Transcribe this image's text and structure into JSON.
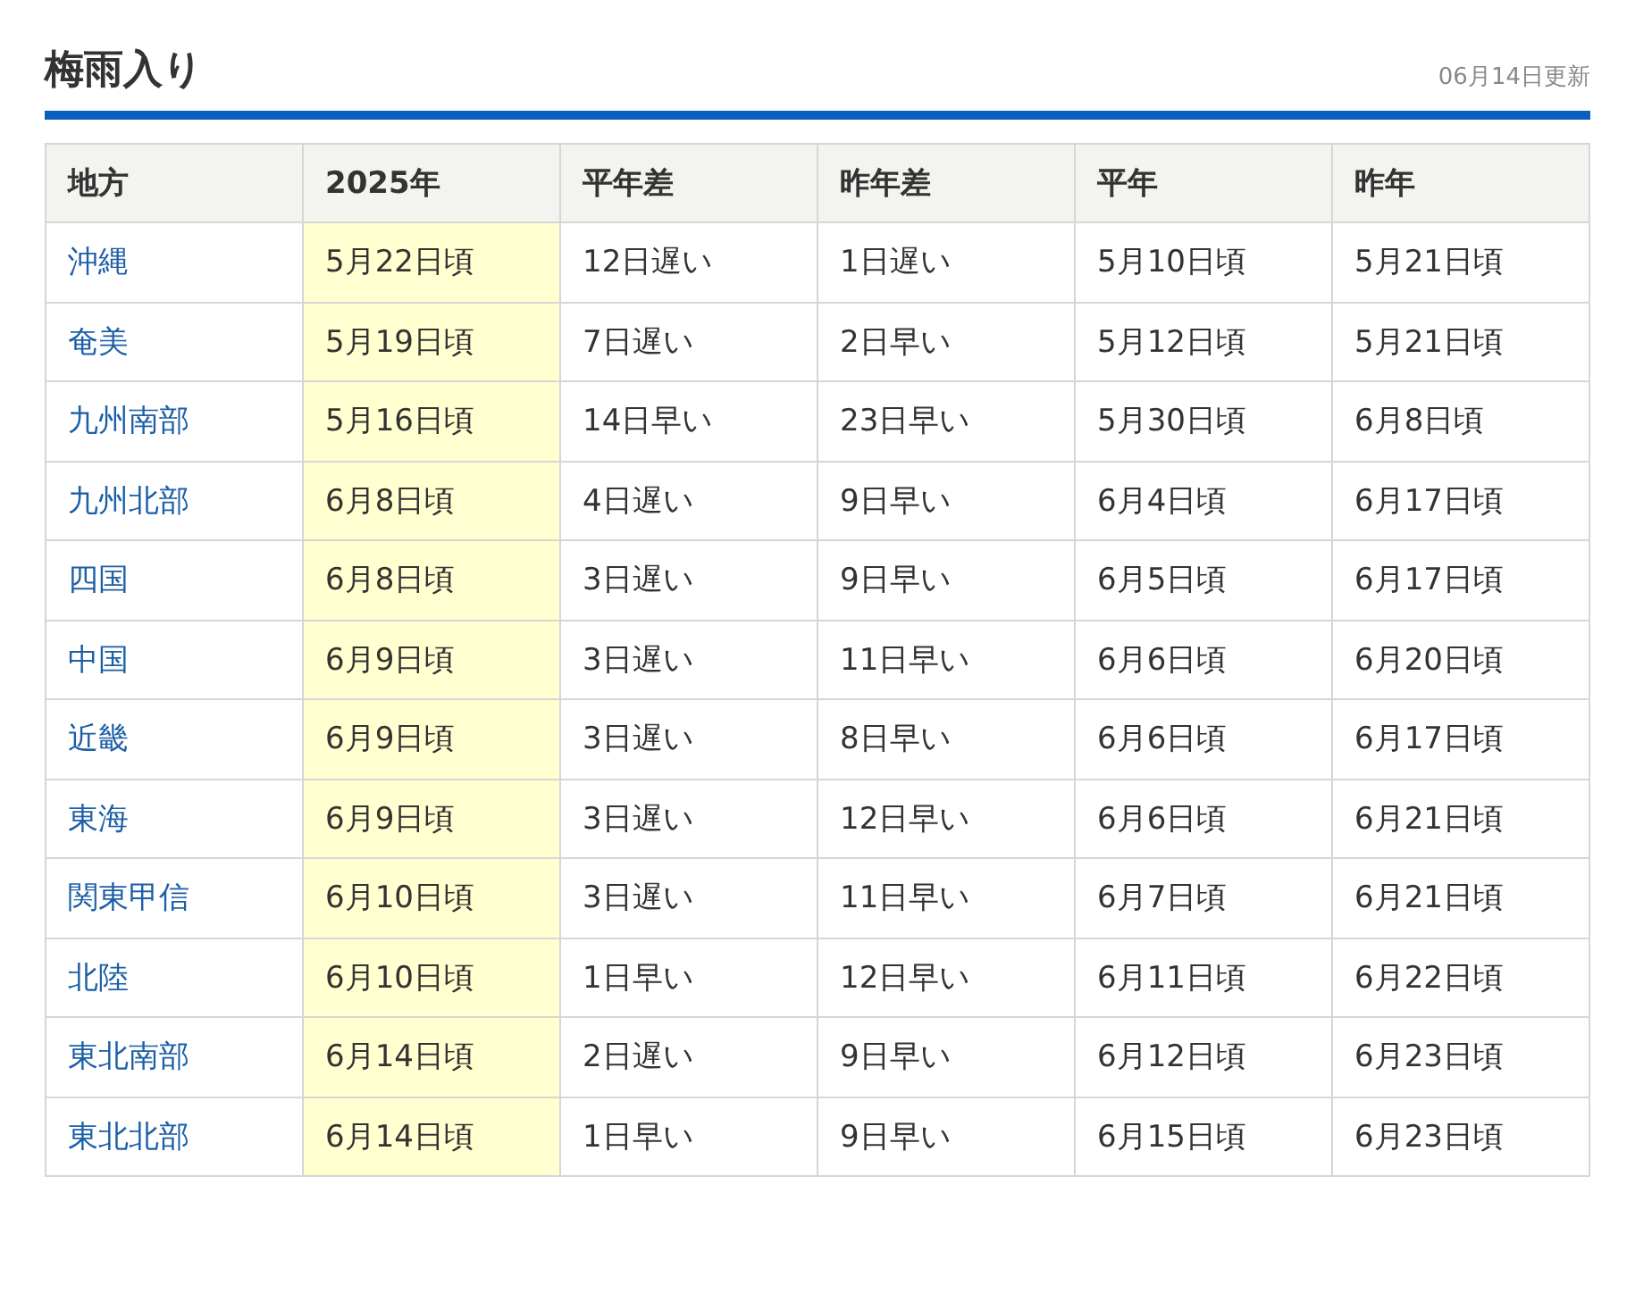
{
  "header": {
    "title": "梅雨入り",
    "updated": "06月14日更新"
  },
  "table": {
    "columns": [
      {
        "label": "地方",
        "highlighted": false
      },
      {
        "label": "2025年",
        "highlighted": true
      },
      {
        "label": "平年差",
        "highlighted": false
      },
      {
        "label": "昨年差",
        "highlighted": false
      },
      {
        "label": "平年",
        "highlighted": false
      },
      {
        "label": "昨年",
        "highlighted": false
      }
    ],
    "rows": [
      [
        "沖縄",
        "5月22日頃",
        "12日遅い",
        "1日遅い",
        "5月10日頃",
        "5月21日頃"
      ],
      [
        "奄美",
        "5月19日頃",
        "7日遅い",
        "2日早い",
        "5月12日頃",
        "5月21日頃"
      ],
      [
        "九州南部",
        "5月16日頃",
        "14日早い",
        "23日早い",
        "5月30日頃",
        "6月8日頃"
      ],
      [
        "九州北部",
        "6月8日頃",
        "4日遅い",
        "9日早い",
        "6月4日頃",
        "6月17日頃"
      ],
      [
        "四国",
        "6月8日頃",
        "3日遅い",
        "9日早い",
        "6月5日頃",
        "6月17日頃"
      ],
      [
        "中国",
        "6月9日頃",
        "3日遅い",
        "11日早い",
        "6月6日頃",
        "6月20日頃"
      ],
      [
        "近畿",
        "6月9日頃",
        "3日遅い",
        "8日早い",
        "6月6日頃",
        "6月17日頃"
      ],
      [
        "東海",
        "6月9日頃",
        "3日遅い",
        "12日早い",
        "6月6日頃",
        "6月21日頃"
      ],
      [
        "関東甲信",
        "6月10日頃",
        "3日遅い",
        "11日早い",
        "6月7日頃",
        "6月21日頃"
      ],
      [
        "北陸",
        "6月10日頃",
        "1日早い",
        "12日早い",
        "6月11日頃",
        "6月22日頃"
      ],
      [
        "東北南部",
        "6月14日頃",
        "2日遅い",
        "9日早い",
        "6月12日頃",
        "6月23日頃"
      ],
      [
        "東北北部",
        "6月14日頃",
        "1日早い",
        "9日早い",
        "6月15日頃",
        "6月23日頃"
      ]
    ]
  }
}
